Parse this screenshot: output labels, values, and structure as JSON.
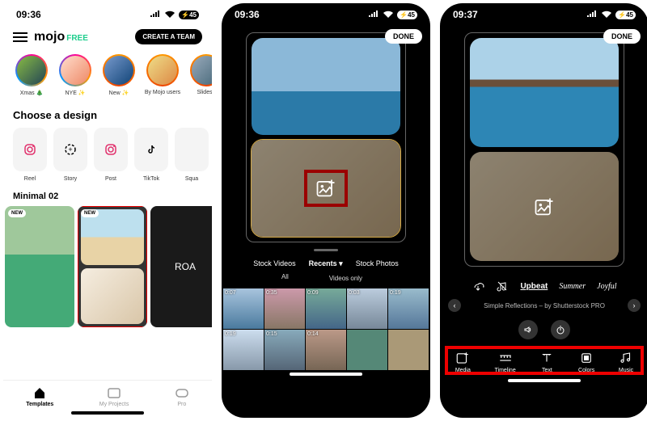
{
  "screen1": {
    "time": "09:36",
    "battery": "45",
    "logo": "mojo",
    "plan": "FREE",
    "cta": "CREATE A TEAM",
    "stories": [
      {
        "label": "Xmas 🎄"
      },
      {
        "label": "NYE ✨"
      },
      {
        "label": "New ✨"
      },
      {
        "label": "By Mojo users"
      },
      {
        "label": "Slidesh"
      }
    ],
    "choose": "Choose a design",
    "designs": [
      {
        "label": "Reel"
      },
      {
        "label": "Story"
      },
      {
        "label": "Post"
      },
      {
        "label": "TikTok"
      },
      {
        "label": "Squa"
      }
    ],
    "template_group": "Minimal 02",
    "new_badge": "NEW",
    "roa": "ROA",
    "tabs": [
      {
        "label": "Templates"
      },
      {
        "label": "My Projects"
      },
      {
        "label": "Pro"
      }
    ]
  },
  "screen2": {
    "time": "09:36",
    "battery": "45",
    "done": "DONE",
    "picker_tabs": [
      "Stock Videos",
      "Recents",
      "Stock Photos"
    ],
    "picker_active": 1,
    "sub_tabs": [
      "All",
      "Videos only"
    ],
    "times": [
      "0:07",
      "0:35",
      "0:09",
      "0:03",
      "0:19",
      "0:19",
      "0:15",
      "0:14"
    ]
  },
  "screen3": {
    "time": "09:37",
    "battery": "45",
    "done": "DONE",
    "music_cats": [
      "Upbeat",
      "Summer",
      "Joyful"
    ],
    "track": "Simple Reflections – by Shutterstock PRO",
    "editor_tabs": [
      {
        "label": "Media"
      },
      {
        "label": "Timeline"
      },
      {
        "label": "Text"
      },
      {
        "label": "Colors"
      },
      {
        "label": "Music"
      }
    ]
  }
}
